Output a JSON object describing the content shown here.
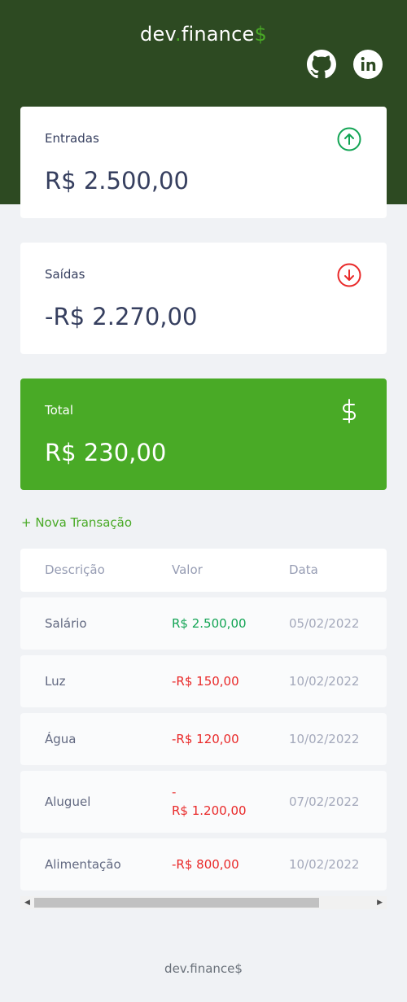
{
  "app": {
    "logo_main": "dev",
    "logo_dot": ".",
    "logo_rest": "finance",
    "logo_dollar": "$"
  },
  "social": {
    "github_icon": "github-icon",
    "linkedin_icon": "linkedin-icon"
  },
  "cards": {
    "income": {
      "label": "Entradas",
      "amount": "R$ 2.500,00",
      "icon": "arrow-up-circle-icon"
    },
    "expense": {
      "label": "Saídas",
      "amount": "-R$ 2.270,00",
      "icon": "arrow-down-circle-icon"
    },
    "total": {
      "label": "Total",
      "amount": "R$ 230,00",
      "icon": "dollar-sign-icon"
    }
  },
  "new_transaction": "+ Nova Transação",
  "table": {
    "headers": [
      "Descrição",
      "Valor",
      "Data"
    ],
    "rows": [
      {
        "description": "Salário",
        "value": "R$ 2.500,00",
        "date": "05/02/2022",
        "type": "income"
      },
      {
        "description": "Luz",
        "value": "-R$ 150,00",
        "date": "10/02/2022",
        "type": "expense"
      },
      {
        "description": "Água",
        "value": "-R$ 120,00",
        "date": "10/02/2022",
        "type": "expense"
      },
      {
        "description": "Aluguel",
        "value_line1": "-",
        "value_line2": "R$ 1.200,00",
        "date": "07/02/2022",
        "type": "expense"
      },
      {
        "description": "Alimentação",
        "value": "-R$ 800,00",
        "date": "10/02/2022",
        "type": "expense"
      }
    ]
  },
  "colors": {
    "header": "#2d4a22",
    "accent": "#49aa26",
    "income": "#12a454",
    "expense": "#e92929",
    "background": "#f0f2f5"
  },
  "footer": "dev.finance$"
}
